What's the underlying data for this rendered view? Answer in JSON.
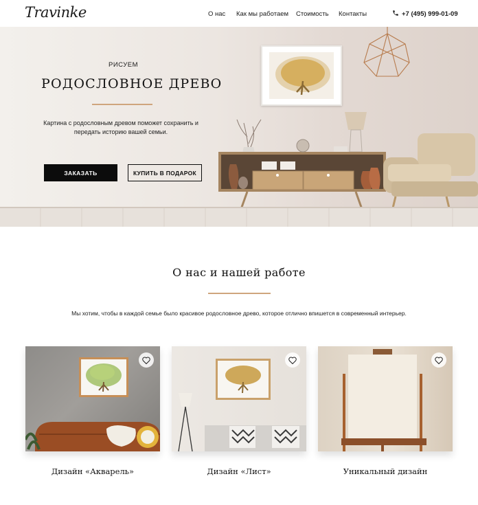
{
  "header": {
    "logo": "Travinke",
    "nav": [
      {
        "label": "О нас"
      },
      {
        "label": "Как мы работаем"
      },
      {
        "label": "Стоимость"
      },
      {
        "label": "Контакты"
      }
    ],
    "phone": "+7 (495) 999-01-09"
  },
  "hero": {
    "subtitle": "РИСУЕМ",
    "title": "РОДОСЛОВНОЕ ДРЕВО",
    "description": "Картина с родословным древом поможет сохранить и передать историю вашей семьи.",
    "order_button": "ЗАКАЗАТЬ",
    "gift_button": "КУПИТЬ В ПОДАРОК"
  },
  "about": {
    "title": "О нас и нашей работе",
    "description": "Мы хотим, чтобы в каждой семье было красивое родословное древо, которое отлично впишется в современный интерьер."
  },
  "cards": [
    {
      "title": "Дизайн «Акварель»"
    },
    {
      "title": "Дизайн «Лист»"
    },
    {
      "title": "Уникальный дизайн"
    }
  ],
  "colors": {
    "accent": "#cfa57d",
    "button_dark": "#0c0c0c"
  }
}
